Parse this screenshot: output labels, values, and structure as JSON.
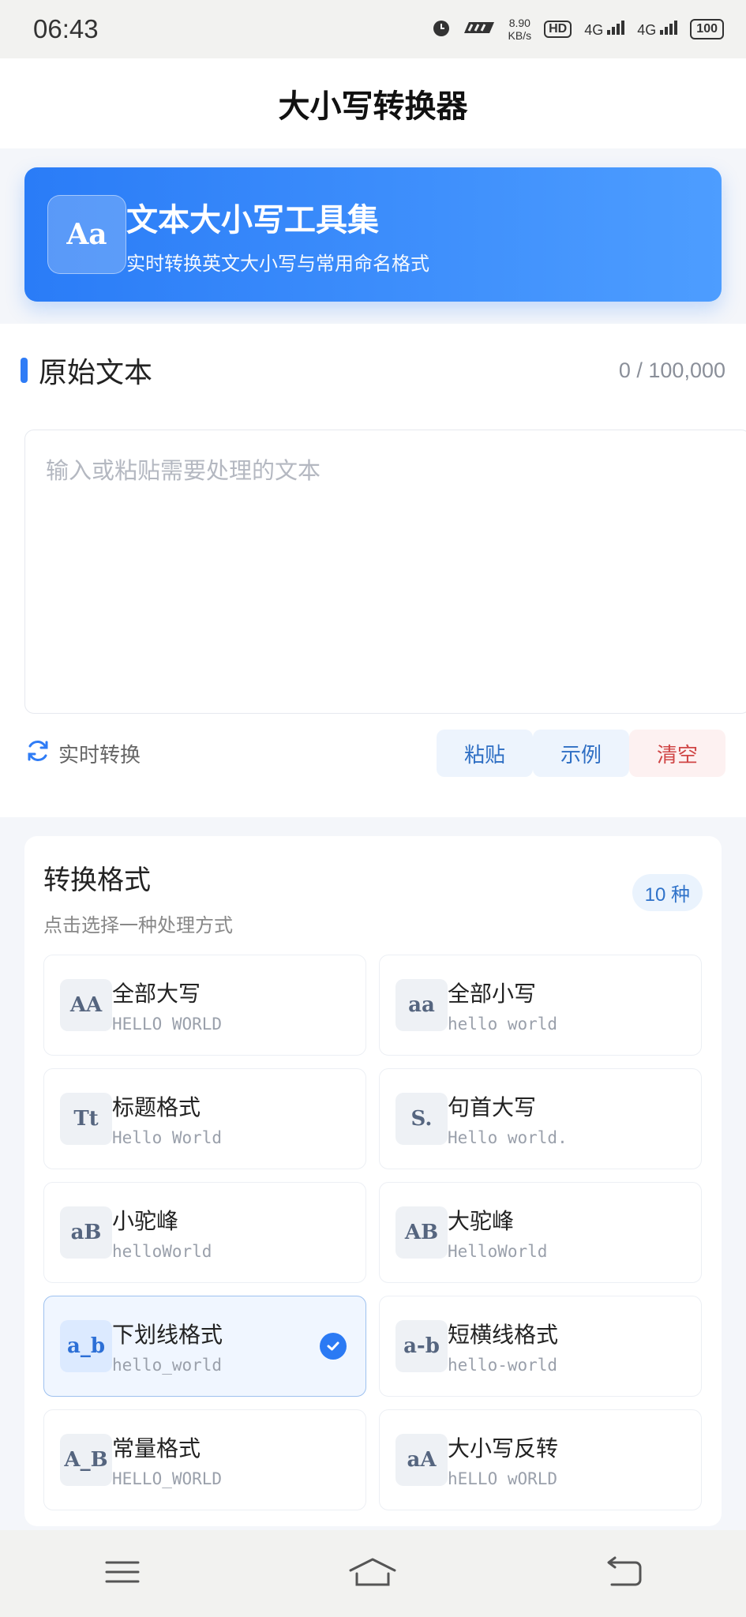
{
  "status_bar": {
    "time": "06:43",
    "speed_value": "8.90",
    "speed_unit": "KB/s",
    "hd": "HD",
    "net1": "4G",
    "net2": "4G",
    "battery": "100"
  },
  "header": {
    "title": "大小写转换器"
  },
  "hero": {
    "icon_text": "Aa",
    "title": "文本大小写工具集",
    "subtitle": "实时转换英文大小写与常用命名格式"
  },
  "input_section": {
    "title": "原始文本",
    "counter": "0 / 100,000",
    "placeholder": "输入或粘贴需要处理的文本",
    "realtime_label": "实时转换",
    "paste_label": "粘贴",
    "example_label": "示例",
    "clear_label": "清空"
  },
  "formats": {
    "title": "转换格式",
    "subtitle": "点击选择一种处理方式",
    "count_badge": "10 种",
    "items": [
      {
        "badge": "AA",
        "name": "全部大写",
        "example": "HELLO WORLD"
      },
      {
        "badge": "aa",
        "name": "全部小写",
        "example": "hello world"
      },
      {
        "badge": "Tt",
        "name": "标题格式",
        "example": "Hello World"
      },
      {
        "badge": "S.",
        "name": "句首大写",
        "example": "Hello world."
      },
      {
        "badge": "aB",
        "name": "小驼峰",
        "example": "helloWorld"
      },
      {
        "badge": "AB",
        "name": "大驼峰",
        "example": "HelloWorld"
      },
      {
        "badge": "a_b",
        "name": "下划线格式",
        "example": "hello_world"
      },
      {
        "badge": "a-b",
        "name": "短横线格式",
        "example": "hello-world"
      },
      {
        "badge": "A_B",
        "name": "常量格式",
        "example": "HELLO_WORLD"
      },
      {
        "badge": "aA",
        "name": "大小写反转",
        "example": "hELLO wORLD"
      }
    ]
  },
  "colors": {
    "accent": "#2f7cf6",
    "danger": "#d04646"
  }
}
